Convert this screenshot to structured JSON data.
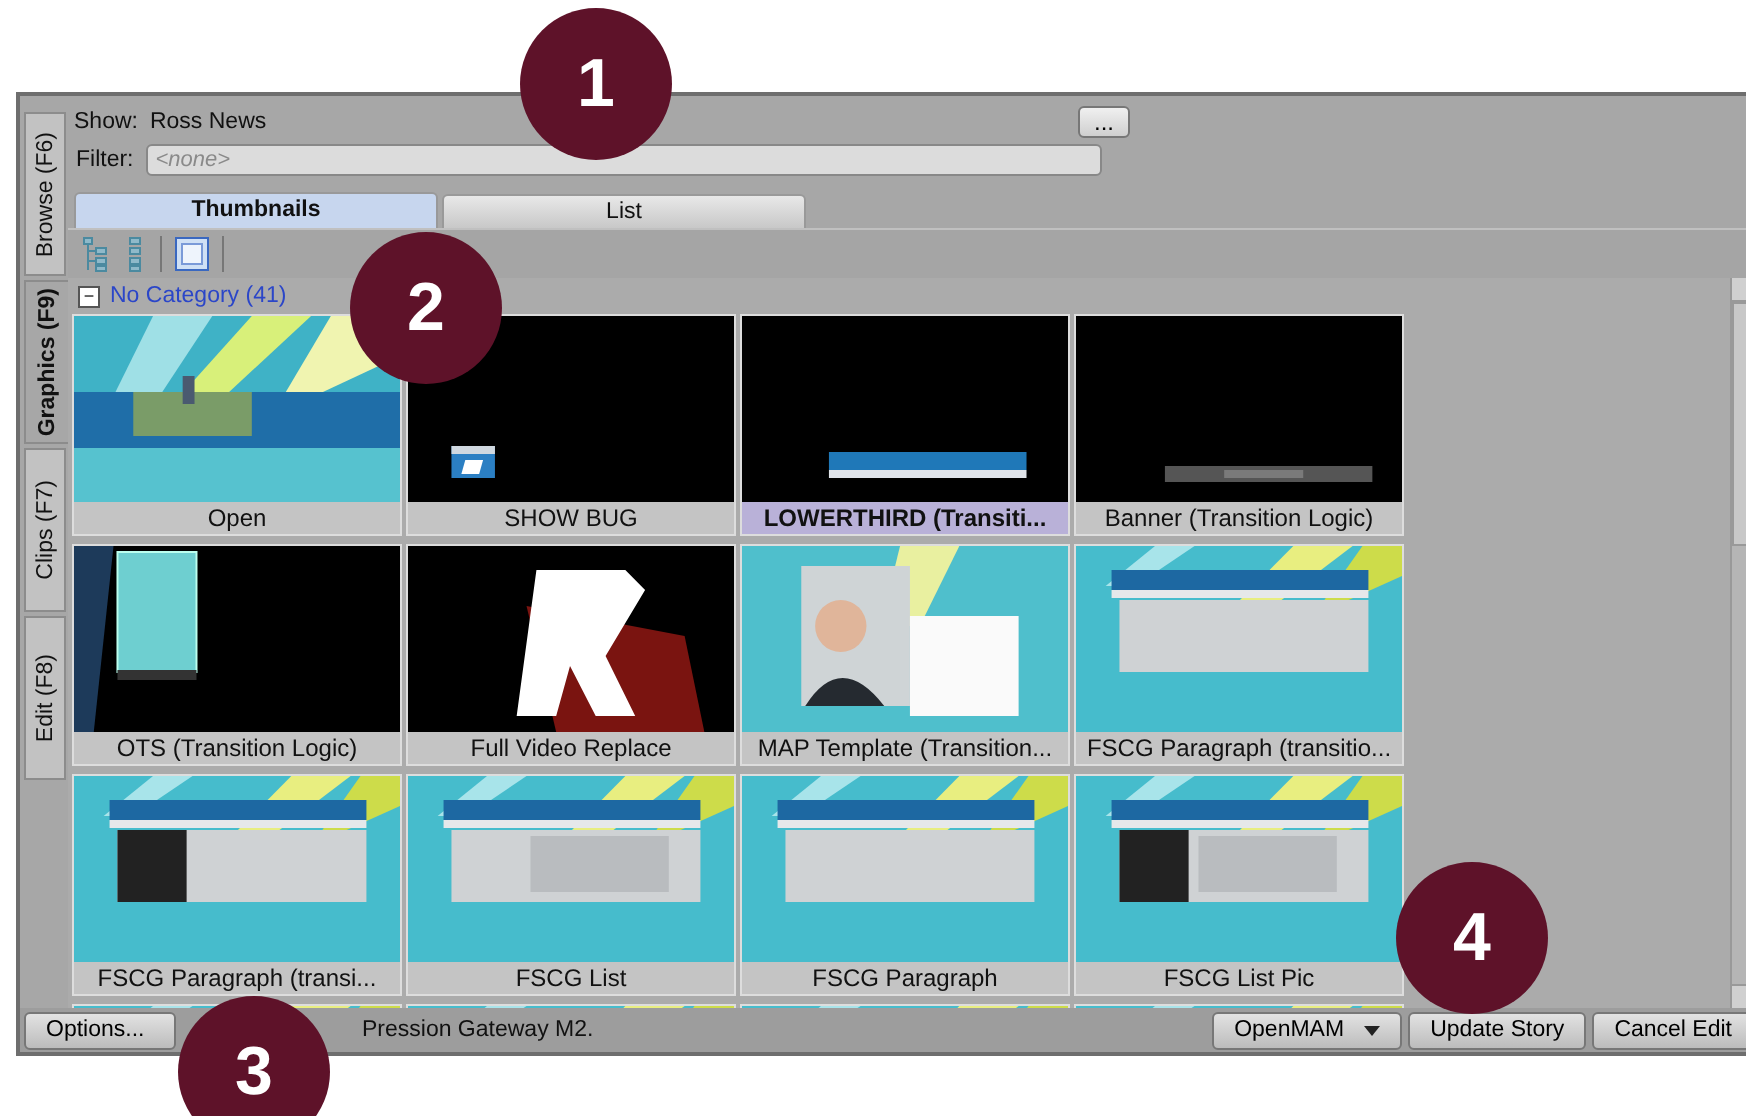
{
  "side_tabs": [
    {
      "label": "Browse (F6)",
      "selected": false
    },
    {
      "label": "Graphics (F9)",
      "selected": true
    },
    {
      "label": "Clips (F7)",
      "selected": false
    },
    {
      "label": "Edit (F8)",
      "selected": false
    }
  ],
  "show": {
    "label": "Show:",
    "value": "Ross News",
    "browse_button": "..."
  },
  "filter": {
    "label": "Filter:",
    "placeholder": "<none>"
  },
  "view_tabs": [
    {
      "label": "Thumbnails",
      "selected": true
    },
    {
      "label": "List",
      "selected": false
    }
  ],
  "category": {
    "toggle": "−",
    "label": "No Category (41)",
    "expanded": true
  },
  "items": [
    {
      "label": "Open",
      "selected": false
    },
    {
      "label": "SHOW BUG",
      "selected": false
    },
    {
      "label": "LOWERTHIRD (Transiti...",
      "selected": true
    },
    {
      "label": "Banner (Transition Logic)",
      "selected": false
    },
    {
      "label": "OTS (Transition Logic)",
      "selected": false
    },
    {
      "label": "Full Video Replace",
      "selected": false
    },
    {
      "label": "MAP Template (Transition...",
      "selected": false
    },
    {
      "label": "FSCG Paragraph (transitio...",
      "selected": false
    },
    {
      "label": "FSCG Paragraph (transi...",
      "selected": false
    },
    {
      "label": "FSCG List",
      "selected": false
    },
    {
      "label": "FSCG Paragraph",
      "selected": false
    },
    {
      "label": "FSCG List Pic",
      "selected": false
    },
    {
      "selected": false
    },
    {
      "selected": false
    },
    {
      "selected": false
    },
    {
      "selected": false
    }
  ],
  "footer": {
    "options": "Options...",
    "status": "Pression Gateway M2.",
    "openmam": "OpenMAM",
    "update": "Update Story",
    "cancel": "Cancel Edit"
  },
  "callouts": [
    "1",
    "2",
    "3",
    "4"
  ]
}
